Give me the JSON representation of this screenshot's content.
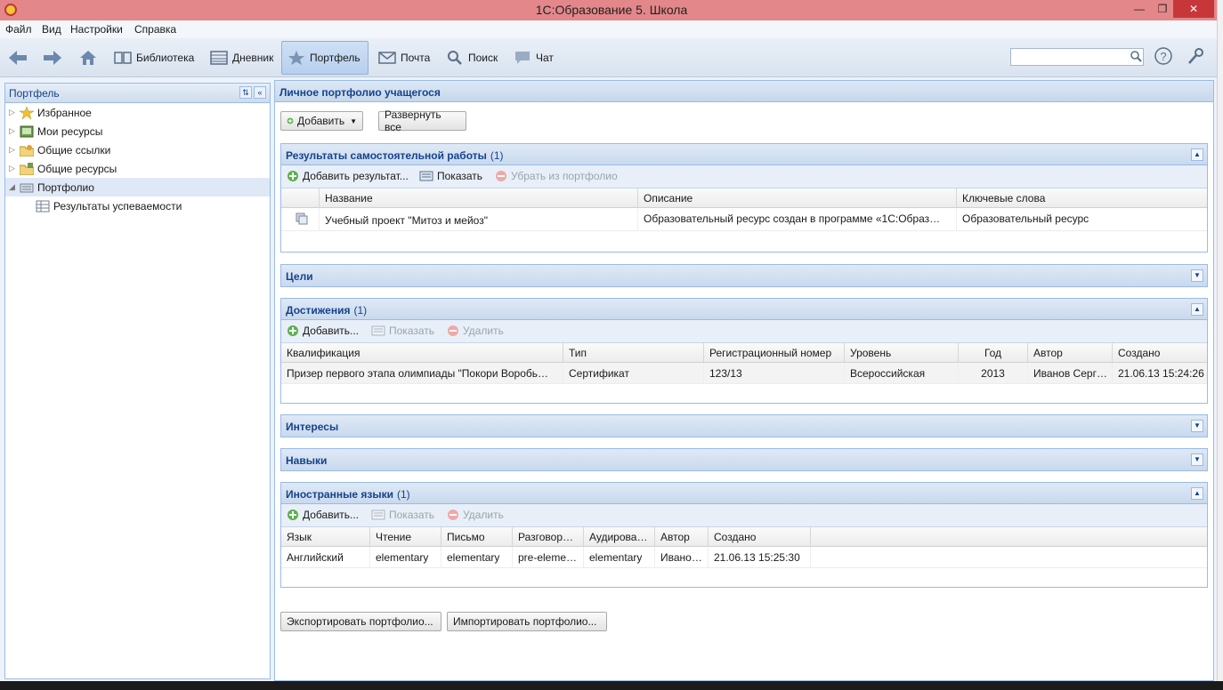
{
  "window": {
    "title": "1С:Образование 5. Школа"
  },
  "menu": [
    "Файл",
    "Вид",
    "Настройки",
    "Справка"
  ],
  "toolbar": {
    "items": [
      {
        "label": "Библиотека",
        "icon": "book-icon"
      },
      {
        "label": "Дневник",
        "icon": "diary-icon"
      },
      {
        "label": "Портфель",
        "icon": "star-icon",
        "active": true
      },
      {
        "label": "Почта",
        "icon": "mail-icon"
      },
      {
        "label": "Поиск",
        "icon": "search-icon"
      },
      {
        "label": "Чат",
        "icon": "chat-icon"
      }
    ],
    "search_value": ""
  },
  "left": {
    "title": "Портфель",
    "tree": [
      {
        "label": "Избранное",
        "icon": "star-icon"
      },
      {
        "label": "Мои ресурсы",
        "icon": "resources-icon"
      },
      {
        "label": "Общие ссылки",
        "icon": "folder-link-icon"
      },
      {
        "label": "Общие ресурсы",
        "icon": "folder-icon"
      },
      {
        "label": "Портфолио",
        "icon": "portfolio-icon",
        "selected": true,
        "expanded": true
      },
      {
        "label": "Результаты успеваемости",
        "icon": "table-icon",
        "child": true
      }
    ]
  },
  "main": {
    "title": "Личное портфолио учащегося",
    "add_label": "Добавить",
    "expand_all_label": "Развернуть все",
    "sections": {
      "results": {
        "title": "Результаты самостоятельной работы",
        "count": "(1)",
        "tools": [
          "Добавить результат...",
          "Показать",
          "Убрать из портфолио"
        ],
        "columns": [
          "Название",
          "Описание",
          "Ключевые слова"
        ],
        "rows": [
          [
            "Учебный проект \"Митоз и мейоз\"",
            "Образовательный ресурс создан в программе «1С:Образ…",
            "Образовательный ресурс"
          ]
        ]
      },
      "goals": {
        "title": "Цели"
      },
      "achievements": {
        "title": "Достижения",
        "count": "(1)",
        "tools": [
          "Добавить...",
          "Показать",
          "Удалить"
        ],
        "columns": [
          "Квалификация",
          "Тип",
          "Регистрационный номер",
          "Уровень",
          "Год",
          "Автор",
          "Создано"
        ],
        "rows": [
          [
            "Призер первого этапа олимпиады \"Покори Воробь…",
            "Сертификат",
            "123/13",
            "Всероссийская",
            "2013",
            "Иванов Серг…",
            "21.06.13 15:24:26"
          ]
        ]
      },
      "interests": {
        "title": "Интересы"
      },
      "skills": {
        "title": "Навыки"
      },
      "languages": {
        "title": "Иностранные языки",
        "count": "(1)",
        "tools": [
          "Добавить...",
          "Показать",
          "Удалить"
        ],
        "columns": [
          "Язык",
          "Чтение",
          "Письмо",
          "Разговор…",
          "Аудирова…",
          "Автор",
          "Создано"
        ],
        "rows": [
          [
            "Английский",
            "elementary",
            "elementary",
            "pre-eleme…",
            "elementary",
            "Ивано…",
            "21.06.13 15:25:30"
          ]
        ]
      }
    },
    "export_label": "Экспортировать портфолио...",
    "import_label": "Импортировать портфолио..."
  },
  "colors": {
    "title_bar": "#e4878a",
    "close_button": "#c7373a",
    "panel_header_text": "#15428b",
    "panel_border": "#99bbe8"
  }
}
